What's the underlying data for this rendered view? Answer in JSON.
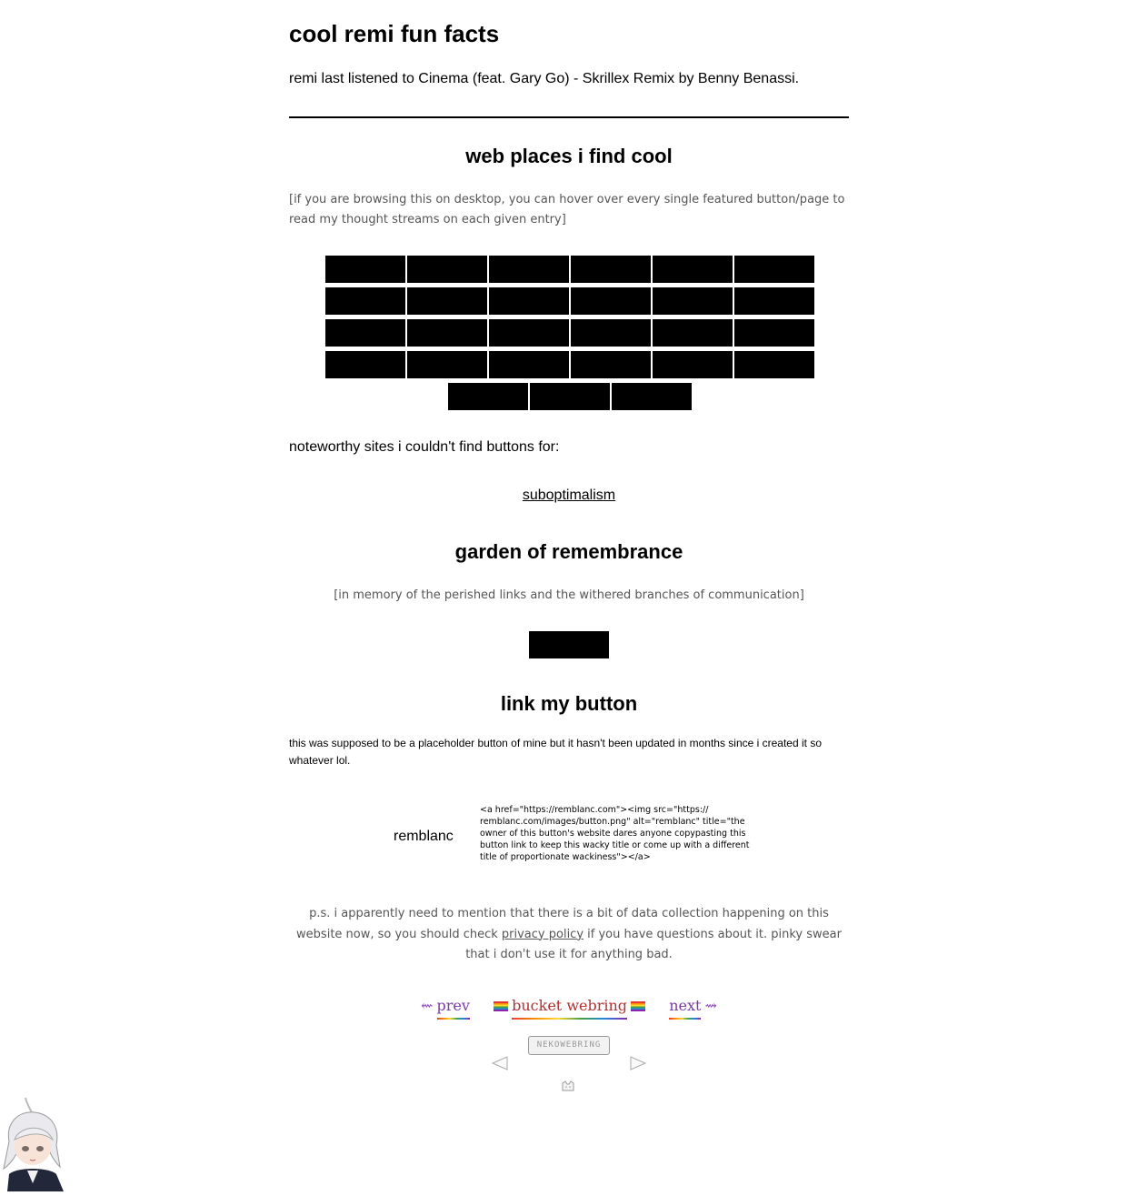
{
  "header": {
    "title": "cool remi fun facts",
    "now_playing": "remi last listened to Cinema (feat. Gary Go) - Skrillex Remix by Benny Benassi."
  },
  "web_places": {
    "heading": "web places i find cool",
    "note": "[if you are browsing this on desktop, you can hover over every single featured button/page to read my thought streams on each given entry]",
    "button_rows": [
      6,
      6,
      6,
      6,
      3
    ],
    "no_button_text": "noteworthy sites i couldn't find buttons for:",
    "text_links": [
      "suboptimalism"
    ]
  },
  "garden": {
    "heading": "garden of remembrance",
    "note": "[in memory of the perished links and the withered branches of communication]"
  },
  "link_button": {
    "heading": "link my button",
    "description": "this was supposed to be a placeholder button of mine but it hasn't been updated in months since i created it so whatever lol.",
    "button_label": "remblanc",
    "embed_code": "<a href=\"https://remblanc.com\"><img src=\"https:// remblanc.com/images/button.png\" alt=\"remblanc\" title=\"the owner of this button's website dares anyone copypasting this button link to keep this wacky title or come up with a different title of proportionate wackiness\"></a>"
  },
  "footer": {
    "ps_before": "p.s. i apparently need to mention that there is a bit of data collection happening on this website now, so you should check ",
    "ps_link": "privacy policy",
    "ps_after": " if you have questions about it. pinky swear that i don't use it for anything bad.",
    "webring": {
      "prev_label": "prev",
      "name": "bucket webring",
      "next_label": "next"
    },
    "nekoweb_label": "NEKOWEBRING"
  }
}
